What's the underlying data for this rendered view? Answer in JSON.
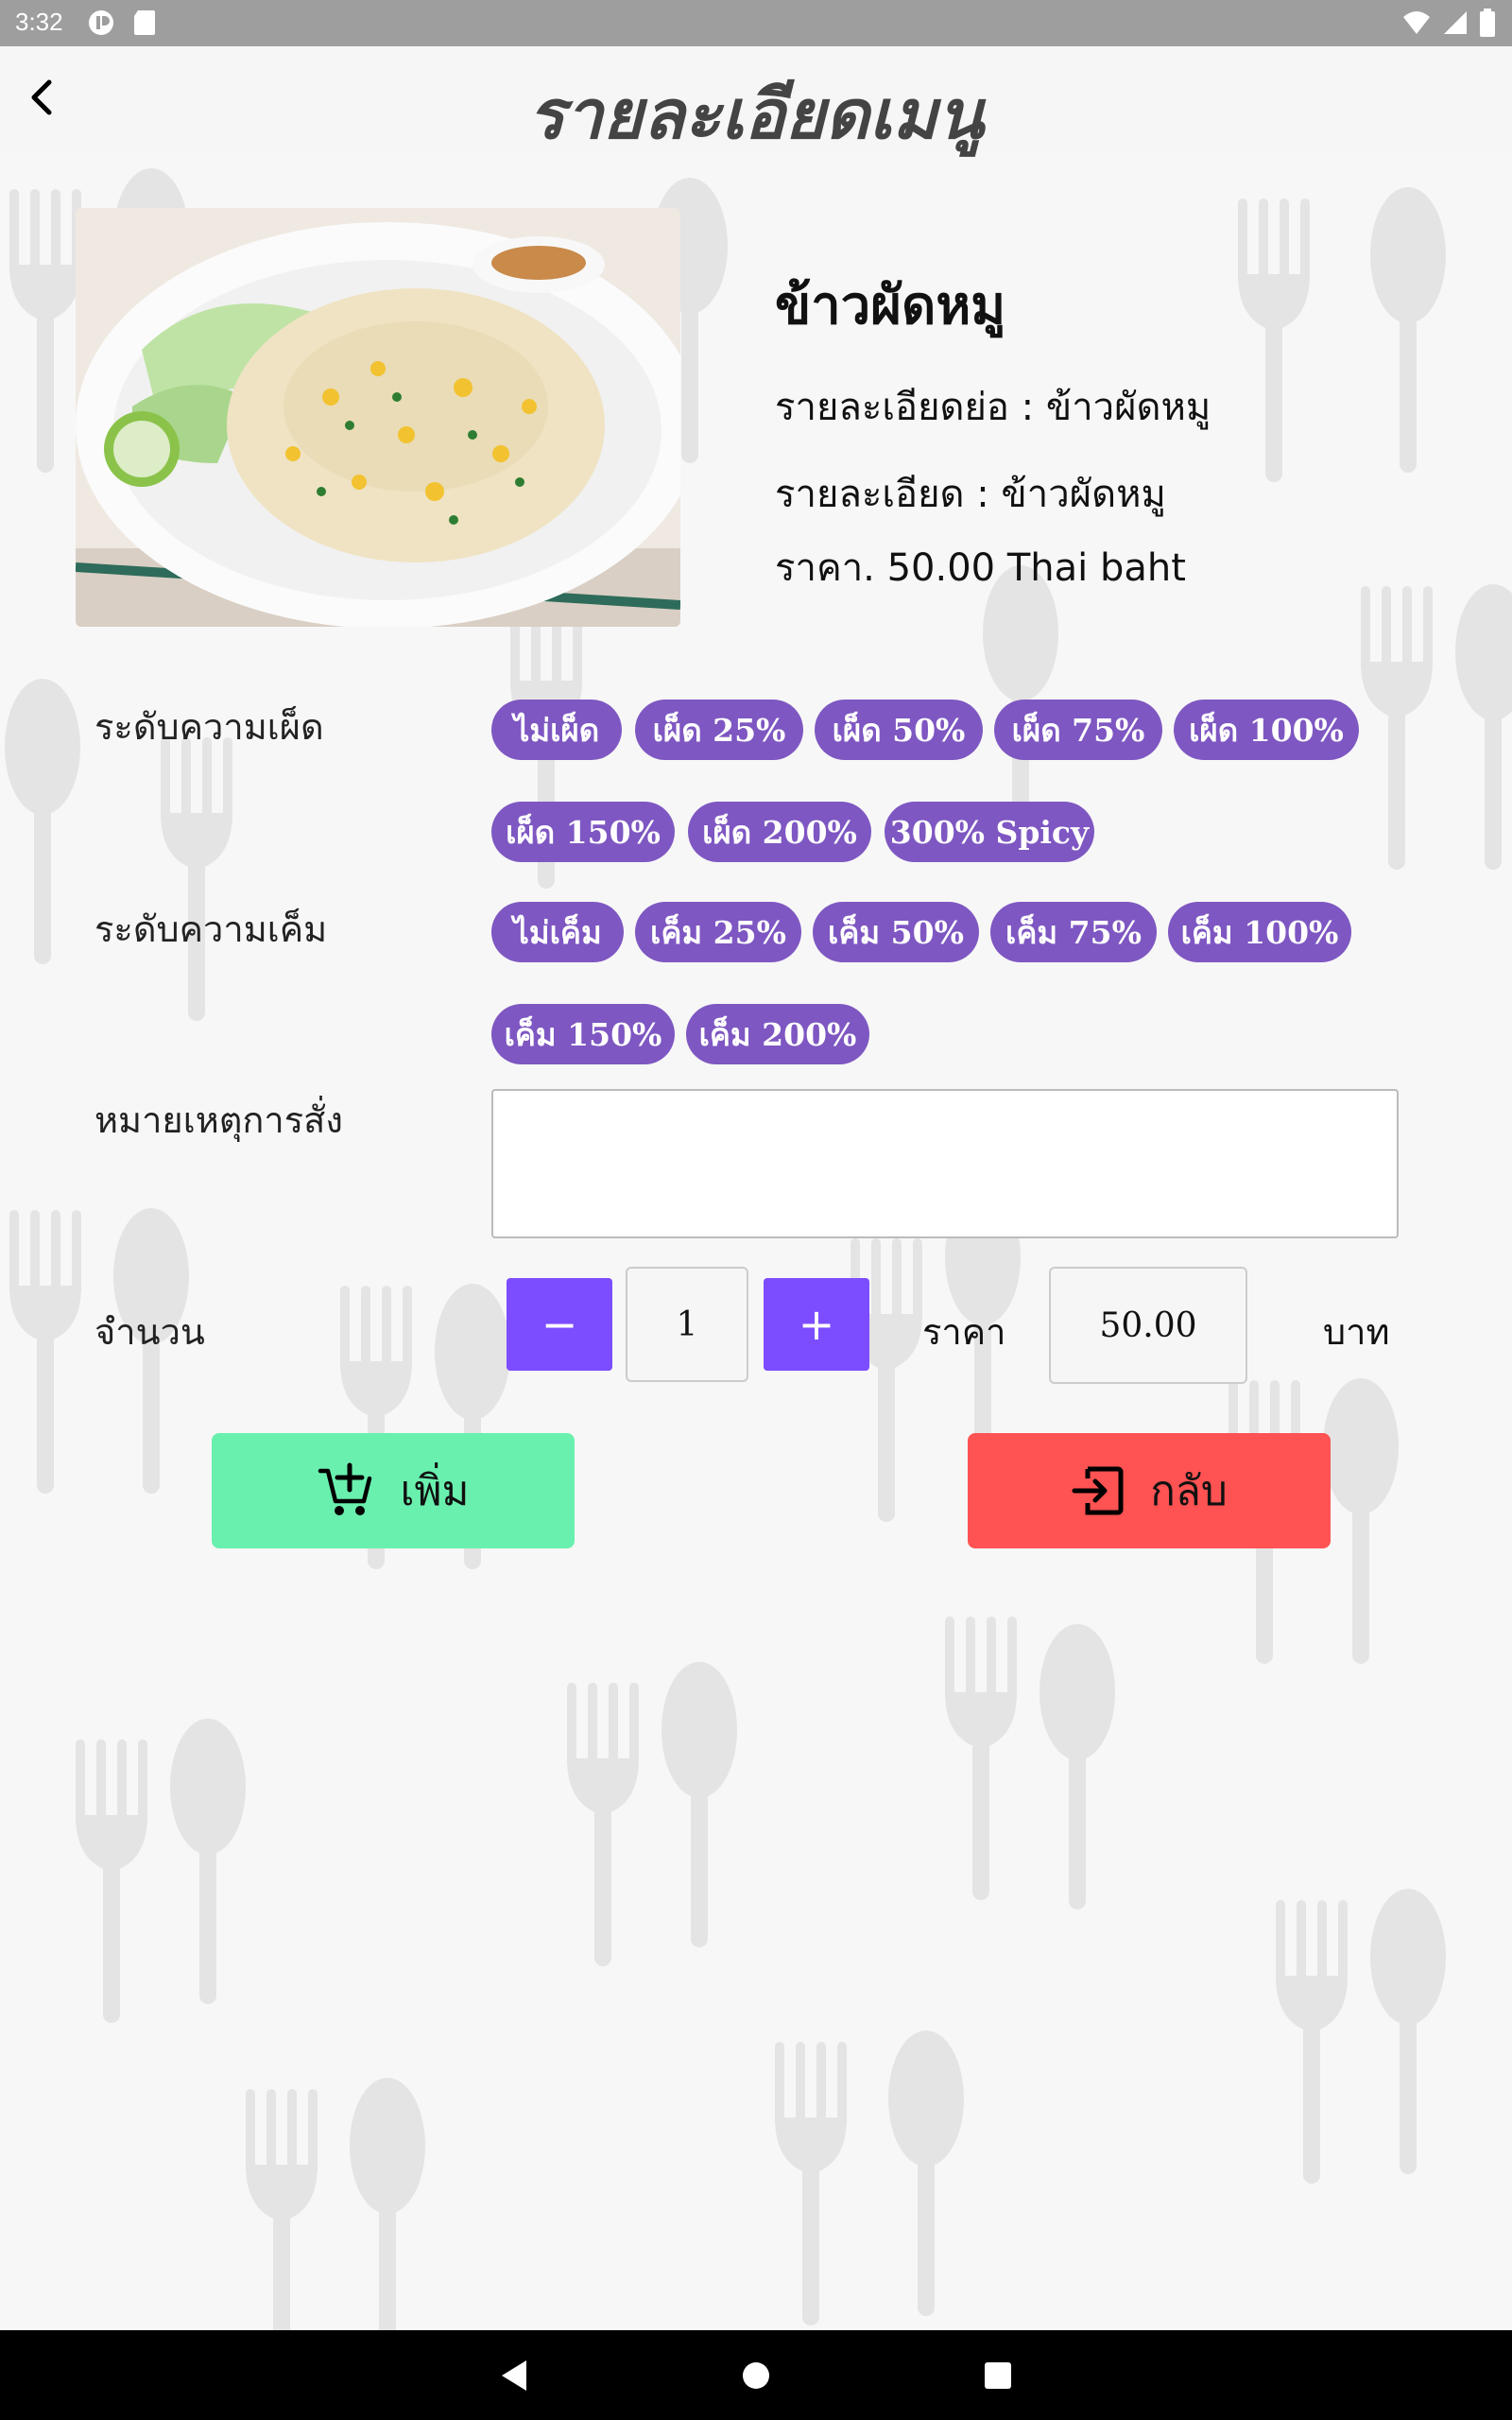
{
  "status_bar": {
    "time": "3:32"
  },
  "app_bar": {
    "title": "รายละเอียดเมนู"
  },
  "menu": {
    "name": "ข้าวผัดหมู",
    "short_detail": "รายละเอียดย่อ : ข้าวผัดหมู",
    "detail": "รายละเอียด : ข้าวผัดหมู",
    "price": "ราคา. 50.00 Thai baht"
  },
  "spicy": {
    "label": "ระดับความเผ็ด",
    "options": [
      "ไม่เผ็ด",
      "เผ็ด 25%",
      "เผ็ด 50%",
      "เผ็ด 75%",
      "เผ็ด 100%",
      "เผ็ด 150%",
      "เผ็ด 200%",
      "300% Spicy"
    ]
  },
  "salty": {
    "label": "ระดับความเค็ม",
    "options": [
      "ไม่เค็ม",
      "เค็ม 25%",
      "เค็ม 50%",
      "เค็ม 75%",
      "เค็ม 100%",
      "เค็ม 150%",
      "เค็ม 200%"
    ]
  },
  "note": {
    "label": "หมายเหตุการสั่ง",
    "value": ""
  },
  "quantity": {
    "label": "จำนวน",
    "minus": "−",
    "value": "1",
    "plus": "+",
    "price_label": "ราคา",
    "price_value": "50.00",
    "unit": "บาท"
  },
  "actions": {
    "add_label": "เพิ่ม",
    "back_label": "กลับ"
  },
  "colors": {
    "chip": "#7e57c2",
    "stepper": "#7c4dff",
    "add_button": "#69f0ae",
    "back_button": "#ff5252",
    "status_bar": "#9e9e9e"
  }
}
